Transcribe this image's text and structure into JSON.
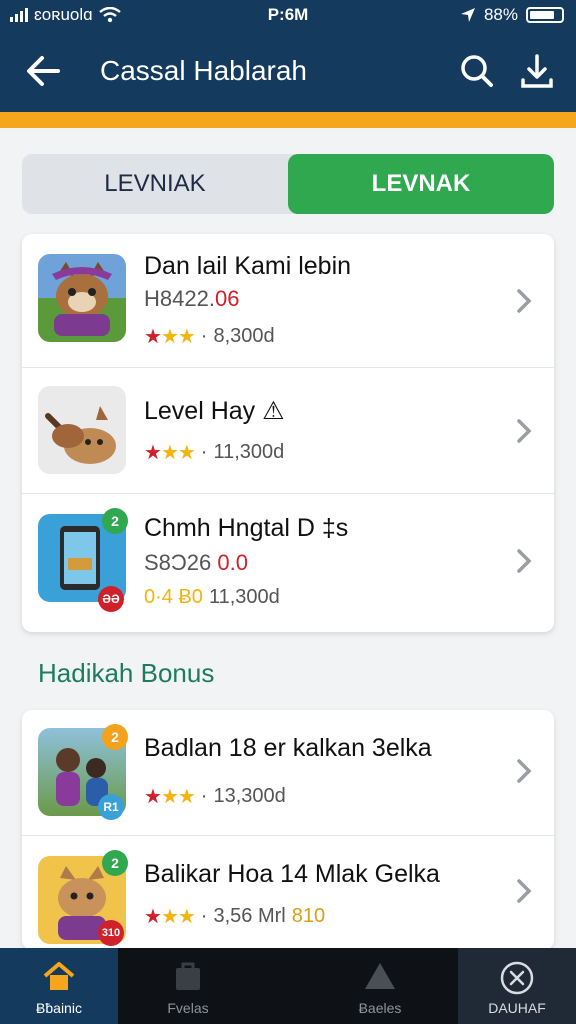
{
  "status": {
    "carrier": "ɛoʀuolɑ",
    "time": "P:6M",
    "battery": "88%"
  },
  "header": {
    "title": "Cassal Hablarah"
  },
  "segment": {
    "left": "LEVNIAK",
    "right": "LEVNAK"
  },
  "list1": [
    {
      "title": "Dan lail Kami lebin",
      "price": "H8422.",
      "price_red": "06",
      "meta": "8,300d"
    },
    {
      "title": "Level Hay ⚠",
      "price": "",
      "price_red": "",
      "meta": "11,300d"
    },
    {
      "title": "Chmh Hngtal D ‡s",
      "price": "S8Ɔ26 ",
      "price_red": "0.0",
      "meta": "11,300d",
      "meta_prefix": "0·4 Ƀ0"
    }
  ],
  "section": {
    "title": "Hadikah Bonus"
  },
  "list2": [
    {
      "title": "Badlan 18 er kalkan 3elka",
      "meta": "13,300d",
      "badge_top": "2",
      "badge_bottom": "R1"
    },
    {
      "title": "Balikar Hoa 14 Mlak Gelka",
      "meta": "3,56 Mrl",
      "meta_extra": "810"
    }
  ],
  "list1_badges": {
    "row3_top": "2",
    "row3_bottom": "ƏƏ"
  },
  "list2_badges": {
    "row2_top": "2",
    "row2_bottom": "310"
  },
  "nav": [
    {
      "label": "Ƀƀainic"
    },
    {
      "label": "Fvelas"
    },
    {
      "label": "Ƀaeles"
    },
    {
      "label": "DAUHAF"
    }
  ],
  "colors": {
    "appbar": "#143a5e",
    "accent": "#f5a61c",
    "green": "#2fa84f",
    "section": "#1c7c5c"
  }
}
